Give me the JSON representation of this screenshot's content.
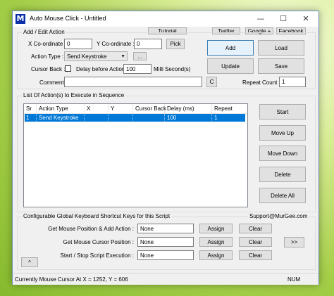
{
  "window": {
    "title": "Auto Mouse Click - Untitled",
    "logo_letter": "M",
    "controls": {
      "minimize": "—",
      "maximize": "☐",
      "close": "✕"
    }
  },
  "top_links": {
    "tutorial": "Tutorial",
    "twitter": "Twitter",
    "google": "Google +",
    "facebook": "Facebook"
  },
  "add_edit": {
    "group_label": "Add / Edit Action",
    "x_label": "X Co-ordinate :",
    "x_value": "0",
    "y_label": "Y Co-ordinate :",
    "y_value": "0",
    "pick": "Pick",
    "action_type_label": "Action Type :",
    "action_type_value": "Send Keystroke",
    "ellipsis": "...",
    "cursor_back_label": "Cursor Back :",
    "delay_label": "Delay before Action :",
    "delay_value": "100",
    "delay_unit": "Milli Second(s)",
    "comment_label": "Comment :",
    "comment_value": "",
    "c_button": "C",
    "repeat_label": "Repeat Count :",
    "repeat_value": "1"
  },
  "side_buttons": {
    "add": "Add",
    "load": "Load",
    "update": "Update",
    "save": "Save"
  },
  "list": {
    "group_label": "List Of Action(s) to Execute in Sequence",
    "columns": [
      "Sr",
      "Action Type",
      "X",
      "Y",
      "Cursor Back",
      "Delay (ms)",
      "Repeat"
    ],
    "rows": [
      {
        "sr": "1",
        "action_type": "Send Keystroke",
        "x": "",
        "y": "",
        "cursor_back": "",
        "delay": "100",
        "repeat": "1"
      }
    ]
  },
  "list_buttons": {
    "start": "Start",
    "move_up": "Move Up",
    "move_down": "Move Down",
    "delete": "Delete",
    "delete_all": "Delete All"
  },
  "shortcuts": {
    "group_label": "Configurable Global Keyboard Shortcut Keys for this Script",
    "support": "Support@MurGee.com",
    "rows": [
      {
        "label": "Get Mouse Position & Add Action :",
        "value": "None",
        "assign": "Assign",
        "clear": "Clear"
      },
      {
        "label": "Get Mouse Cursor Position :",
        "value": "None",
        "assign": "Assign",
        "clear": "Clear"
      },
      {
        "label": "Start / Stop Script Execution :",
        "value": "None",
        "assign": "Assign",
        "clear": "Clear"
      }
    ],
    "more": ">>",
    "collapse": "^"
  },
  "status": {
    "cursor_text": "Currently Mouse Cursor At X = 1252, Y = 606",
    "num": "NUM"
  }
}
